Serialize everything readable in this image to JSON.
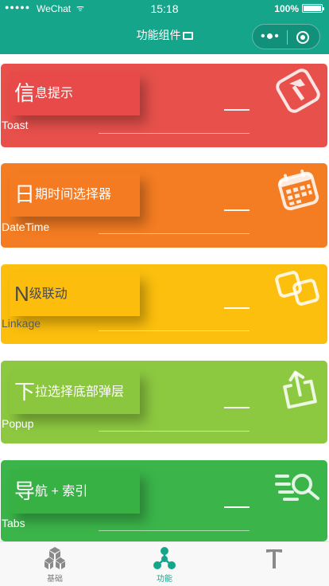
{
  "status": {
    "signal": "●●●●●",
    "carrier": "WeChat",
    "wifi": "ᯤ",
    "time": "15:18",
    "battery": "100%"
  },
  "nav": {
    "title": "功能组件",
    "more": "•●•"
  },
  "cards": [
    {
      "big": "信",
      "rest": "息提示",
      "en": "Toast",
      "icon": "hammer-icon"
    },
    {
      "big": "日",
      "rest": "期时间选择器",
      "en": "DateTime",
      "icon": "calendar-icon"
    },
    {
      "big": "N",
      "rest": "级联动",
      "en": "Linkage",
      "icon": "linked-squares-icon"
    },
    {
      "big": "下",
      "rest": "拉选择底部弹层",
      "en": "Popup",
      "icon": "share-box-icon"
    },
    {
      "big": "导",
      "rest": "航 + 索引",
      "en": "Tabs",
      "icon": "magnifier-icon"
    }
  ],
  "tabbar": {
    "items": [
      {
        "label": "基础",
        "icon": "cubes-icon",
        "active": false
      },
      {
        "label": "功能",
        "icon": "molecule-icon",
        "active": true
      },
      {
        "label": "",
        "icon": "t-tool-icon",
        "active": false
      }
    ]
  },
  "colors": {
    "nav": "#14a58b",
    "toast": "#e7504b",
    "datetime": "#f47c22",
    "linkage": "#fcbf0d",
    "popup": "#8cc940",
    "tabs": "#3bb54a"
  }
}
